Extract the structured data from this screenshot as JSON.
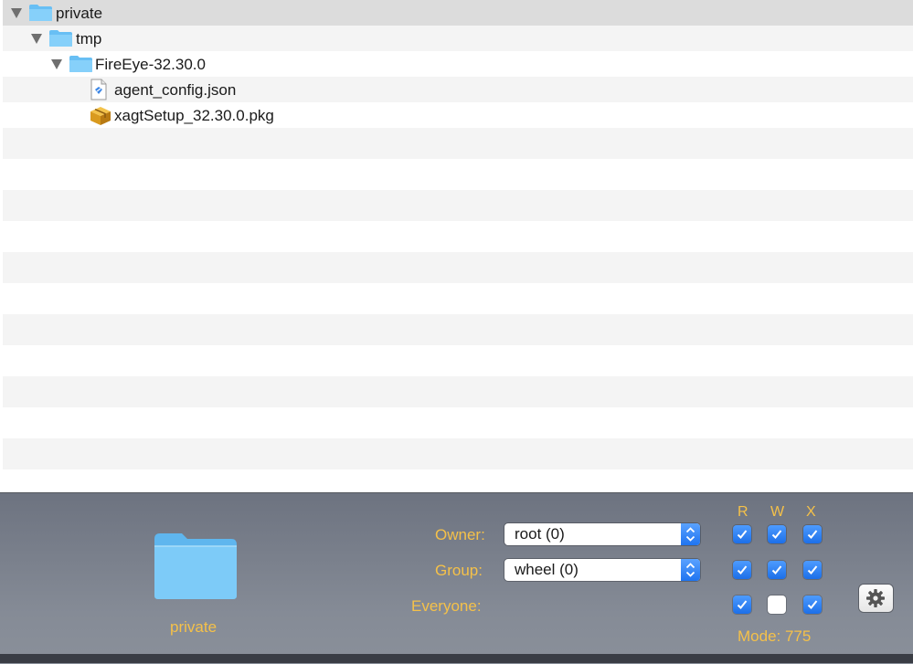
{
  "tree": [
    {
      "label": "private",
      "kind": "folder",
      "level": 0,
      "expanded": true
    },
    {
      "label": "tmp",
      "kind": "folder",
      "level": 1,
      "expanded": true
    },
    {
      "label": "FireEye-32.30.0",
      "kind": "folder",
      "level": 2,
      "expanded": true
    },
    {
      "label": "agent_config.json",
      "kind": "json-file",
      "level": 3
    },
    {
      "label": "xagtSetup_32.30.0.pkg",
      "kind": "package-file",
      "level": 3
    }
  ],
  "info": {
    "item_name": "private",
    "item_icon": "folder-icon",
    "owner_label": "Owner:",
    "owner_value": "root (0)",
    "group_label": "Group:",
    "group_value": "wheel (0)",
    "everyone_label": "Everyone:",
    "col_r": "R",
    "col_w": "W",
    "col_x": "X",
    "permissions": {
      "owner": [
        true,
        true,
        true
      ],
      "group": [
        true,
        true,
        true
      ],
      "everyone": [
        true,
        false,
        true
      ]
    },
    "mode_text": "Mode: 775"
  },
  "colors": {
    "accent": "#f5c149",
    "checkbox_blue": "#1c6fe8",
    "folder_blue": "#6fc2f5"
  }
}
